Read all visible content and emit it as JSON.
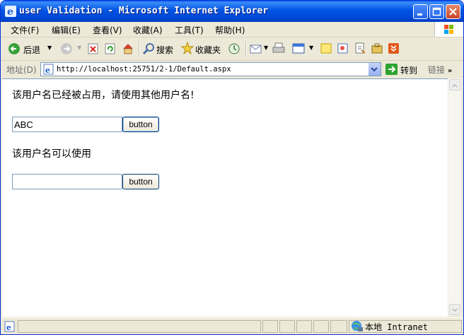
{
  "window": {
    "title": "user Validation - Microsoft Internet Explorer"
  },
  "menu": [
    "文件(F)",
    "编辑(E)",
    "查看(V)",
    "收藏(A)",
    "工具(T)",
    "帮助(H)"
  ],
  "toolbar": {
    "back_label": "后退",
    "search_label": "搜索",
    "favorites_label": "收藏夹"
  },
  "address_bar": {
    "label": "地址(D)",
    "url": "http://localhost:25751/2-1/Default.aspx",
    "go_label": "转到",
    "links_label": "链接"
  },
  "page": {
    "message1": "该用户名已经被占用，请使用其他用户名!",
    "input1_value": "ABC",
    "button1_label": "button",
    "message2": "该用户名可以使用",
    "input2_value": "",
    "button2_label": "button"
  },
  "status": {
    "zone_label": "本地 Intranet"
  }
}
